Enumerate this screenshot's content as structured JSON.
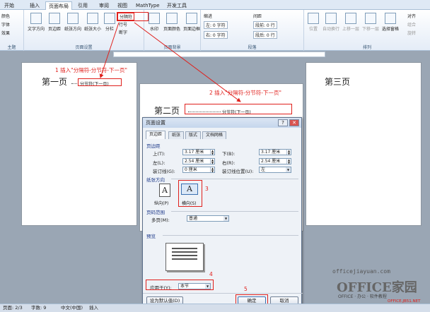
{
  "tabs": [
    "开始",
    "插入",
    "页面布局",
    "引用",
    "审阅",
    "视图",
    "MathType",
    "开发工具"
  ],
  "ribbon": {
    "left_items": [
      "颜色",
      "字体",
      "效果"
    ],
    "buttons": [
      "文字方向",
      "页边距",
      "纸张方向",
      "纸张大小",
      "分栏"
    ],
    "breaks": "分隔符",
    "line_numbers": "行号",
    "hyphenation": "断字",
    "bg_buttons": [
      "水印",
      "页面颜色",
      "页面边框"
    ],
    "indent_label": "缩进",
    "spacing_label": "间距",
    "indent_left": "左: 0 字符",
    "indent_right": "右: 0 字符",
    "spacing_before": "段前: 0 行",
    "spacing_after": "段后: 0 行",
    "arrange_buttons": [
      "位置",
      "自动换行",
      "上移一层",
      "下移一层",
      "选择窗格"
    ],
    "arrange_small": [
      "对齐",
      "组合",
      "旋转"
    ],
    "group_labels": [
      "主题",
      "页面设置",
      "页面背景",
      "段落",
      "排列"
    ]
  },
  "pages": {
    "page1_text": "第一页",
    "page2_text": "第二页",
    "page3_text": "第三页",
    "break_label": "分节符(下一页)"
  },
  "dialog": {
    "title": "页面设置",
    "tabs": [
      "页边距",
      "纸张",
      "版式",
      "文档网格"
    ],
    "section_margins": "页边距",
    "top_label": "上(T):",
    "top_value": "3.17 厘米",
    "bottom_label": "下(B):",
    "bottom_value": "3.17 厘米",
    "left_label": "左(L):",
    "left_value": "2.54 厘米",
    "right_label": "右(R):",
    "right_value": "2.54 厘米",
    "gutter_label": "装订线(G):",
    "gutter_value": "0 厘米",
    "gutter_pos_label": "装订线位置(U):",
    "gutter_pos_value": "左",
    "section_orientation": "纸张方向",
    "portrait": "纵向(P)",
    "landscape": "横向(S)",
    "section_pages": "页码范围",
    "multi_pages_label": "多页(M):",
    "multi_pages_value": "普通",
    "section_preview": "预览",
    "apply_label": "应用于(Y):",
    "apply_value": "本节",
    "default_btn": "设为默认值(D)",
    "ok_btn": "确定",
    "cancel_btn": "取消"
  },
  "annotations": {
    "a1": "1  插入\"分隔符-分节符-下一页\"",
    "a2": "2  插入\"分隔符-分节符-下一页\"",
    "n3": "3",
    "n4": "4",
    "n5": "5"
  },
  "watermark": {
    "url": "officejiayuan.com",
    "brand": "OFFICE家园",
    "tagline": "OFFICE · 办公 · 软件教程",
    "site": "OFFICE.JB51.NET"
  },
  "status": {
    "page": "页面: 2/3",
    "words": "字数: 9",
    "lang": "中文(中国)",
    "mode": "插入"
  },
  "colors": {
    "accent": "#e0201c",
    "ribbon": "#dfe9f5",
    "dialog": "#eef2f7"
  }
}
